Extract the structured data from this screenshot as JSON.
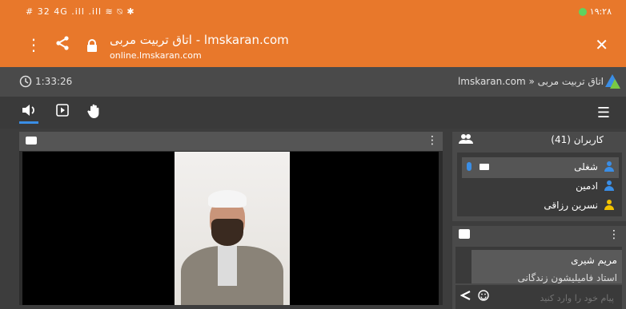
{
  "status_bar": {
    "left_text": "# 32 4G .ill .ill ≋ ⍉ ✱",
    "battery_level": "32",
    "time": "۱۹:۲۸"
  },
  "browser": {
    "page_title": "اتاق تربیت مربی - lmskaran.com",
    "url": "online.lmskaran.com",
    "icons": [
      "more-vert-icon",
      "share-icon",
      "lock-icon",
      "close-icon"
    ]
  },
  "app_header": {
    "timer": "1:33:26",
    "breadcrumb": "lmskaran.com » اتاق تربیت مربی"
  },
  "toolbar": {
    "icons": [
      "speaker-icon",
      "present-icon",
      "raise-hand-icon",
      "hamburger-menu-icon"
    ]
  },
  "users_panel": {
    "title": "کاربران (41)",
    "users": [
      {
        "name": "شغلی",
        "selected": true,
        "icon_color": "#3a8ee6",
        "has_mic": true,
        "has_cam": true
      },
      {
        "name": "ادمین",
        "selected": false,
        "icon_color": "#3a8ee6",
        "has_mic": false,
        "has_cam": false
      },
      {
        "name": "نسرین رزاقی",
        "selected": false,
        "icon_color": "#f2c200",
        "has_mic": false,
        "has_cam": false
      }
    ]
  },
  "chat_panel": {
    "sender": "مریم شیری",
    "message": "استاد فامیلیشون زندگانی",
    "input_placeholder": "پیام خود را وارد کنید"
  },
  "colors": {
    "accent": "#e8782b",
    "highlight": "#3a8ee6"
  }
}
